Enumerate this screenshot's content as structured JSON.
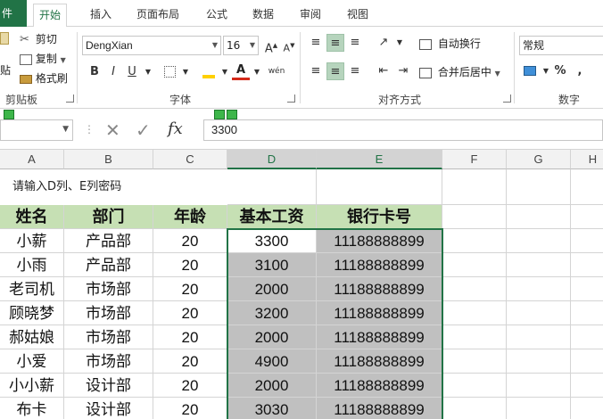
{
  "ribbon": {
    "tabs": [
      {
        "label": "件",
        "name": "tab-file"
      },
      {
        "label": "开始",
        "name": "tab-home"
      },
      {
        "label": "插入",
        "name": "tab-insert"
      },
      {
        "label": "页面布局",
        "name": "tab-page-layout"
      },
      {
        "label": "公式",
        "name": "tab-formulas"
      },
      {
        "label": "数据",
        "name": "tab-data"
      },
      {
        "label": "审阅",
        "name": "tab-review"
      },
      {
        "label": "视图",
        "name": "tab-view"
      }
    ],
    "clipboard": {
      "cut": "剪切",
      "copy": "复制",
      "format_painter": "格式刷",
      "paste": "贴",
      "group": "剪贴板"
    },
    "font": {
      "name": "DengXian",
      "size": "16",
      "group": "字体",
      "bold": "B",
      "italic": "I",
      "underline": "U",
      "phonetic": "wén"
    },
    "alignment": {
      "wrap": "自动换行",
      "merge": "合并后居中",
      "group": "对齐方式"
    },
    "number": {
      "format": "常规",
      "percent": "%",
      "comma": ",",
      "group": "数字"
    }
  },
  "formula_bar": {
    "name_box": "",
    "value": "3300",
    "fx": "fx"
  },
  "grid": {
    "columns": [
      "A",
      "B",
      "C",
      "D",
      "E",
      "F",
      "G",
      "H"
    ],
    "prompt": "请输入D列、E列密码",
    "headers": [
      "姓名",
      "部门",
      "年龄",
      "基本工资",
      "银行卡号"
    ],
    "rows": [
      [
        "小薪",
        "产品部",
        "20",
        "3300",
        "11188888899"
      ],
      [
        "小雨",
        "产品部",
        "20",
        "3100",
        "11188888899"
      ],
      [
        "老司机",
        "市场部",
        "20",
        "2000",
        "11188888899"
      ],
      [
        "顾晓梦",
        "市场部",
        "20",
        "3200",
        "11188888899"
      ],
      [
        "郝姑娘",
        "市场部",
        "20",
        "2000",
        "11188888899"
      ],
      [
        "小爱",
        "市场部",
        "20",
        "4900",
        "11188888899"
      ],
      [
        "小小薪",
        "设计部",
        "20",
        "2000",
        "11188888899"
      ],
      [
        "布卡",
        "设计部",
        "20",
        "3030",
        "11188888899"
      ]
    ]
  },
  "colors": {
    "accent": "#217346",
    "header_fill": "#c6e0b4",
    "selection_fill": "#c0c0c0"
  }
}
